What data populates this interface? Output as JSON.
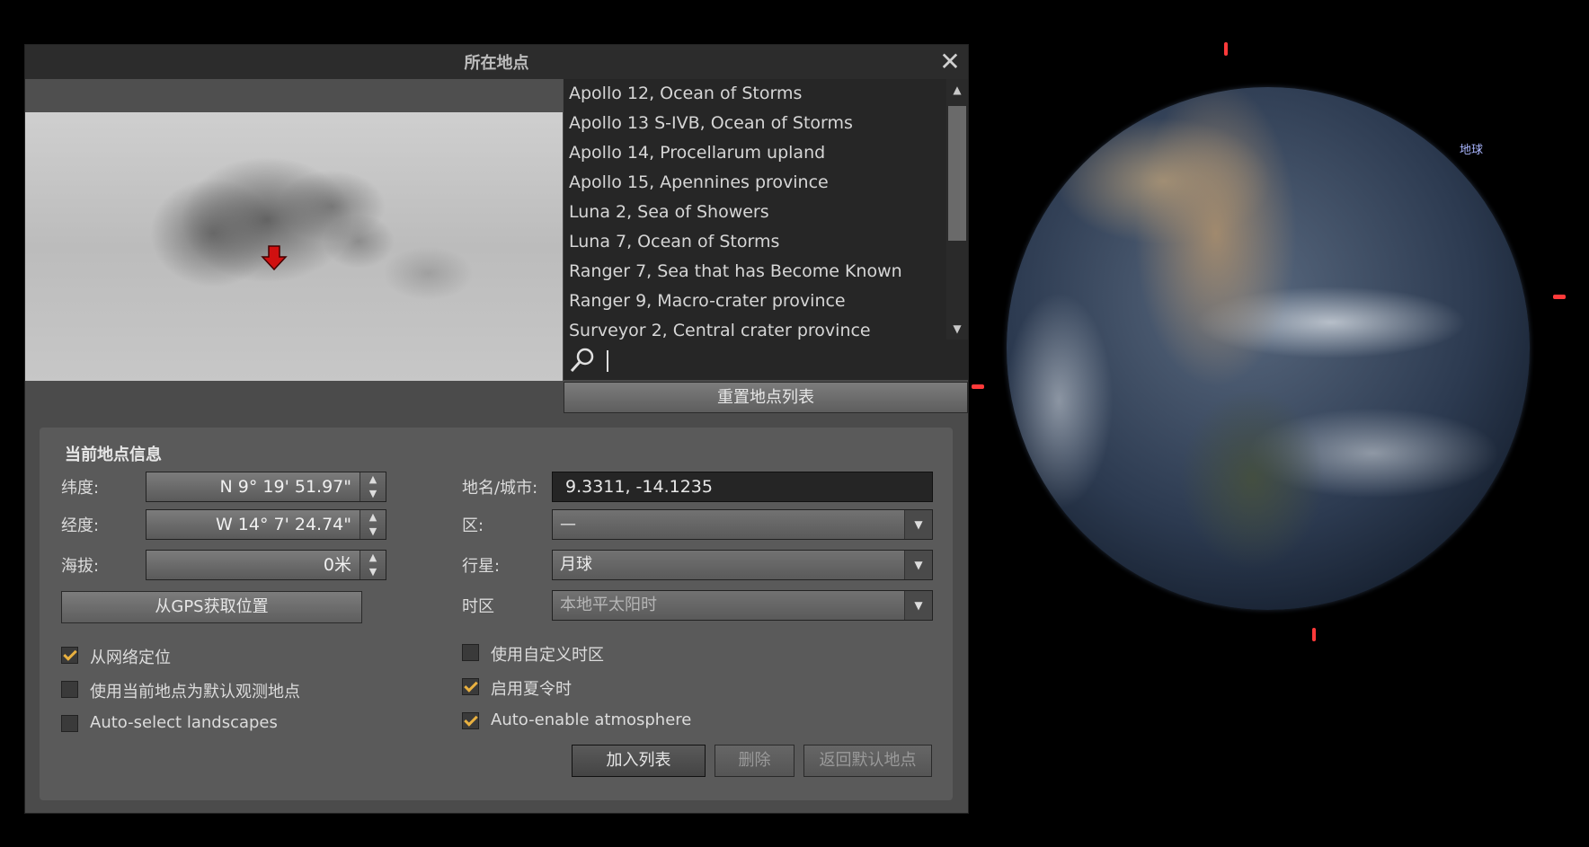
{
  "window": {
    "title": "所在地点"
  },
  "space": {
    "planet_label": "地球"
  },
  "locations": [
    "Apollo 12, Ocean of Storms",
    "Apollo 13 S-IVB, Ocean of Storms",
    "Apollo 14, Procellarum upland",
    "Apollo 15, Apennines province",
    "Luna 2, Sea of Showers",
    "Luna 7, Ocean of Storms",
    "Ranger 7, Sea that has Become Known",
    "Ranger 9, Macro-crater province",
    "Surveyor 2, Central crater province"
  ],
  "search": {
    "value": ""
  },
  "reset_list_label": "重置地点列表",
  "info": {
    "title": "当前地点信息",
    "latitude_label": "纬度:",
    "latitude_value": "N 9° 19' 51.97\"",
    "longitude_label": "经度:",
    "longitude_value": "W 14° 7' 24.74\"",
    "altitude_label": "海拔:",
    "altitude_value": "0米",
    "gps_button": "从GPS获取位置",
    "network_locate": {
      "label": "从网络定位",
      "checked": true
    },
    "use_default": {
      "label": "使用当前地点为默认观测地点",
      "checked": false
    },
    "auto_landscapes": {
      "label": "Auto-select landscapes",
      "checked": false
    },
    "name_label": "地名/城市:",
    "name_value": "9.3311, -14.1235",
    "region_label": "区:",
    "region_value": "—",
    "planet_label": "行星:",
    "planet_value": "月球",
    "timezone_label": "时区",
    "timezone_value": "本地平太阳时",
    "custom_tz": {
      "label": "使用自定义时区",
      "checked": false
    },
    "dst": {
      "label": "启用夏令时",
      "checked": true
    },
    "atmosphere": {
      "label": "Auto-enable atmosphere",
      "checked": true
    },
    "add_button": "加入列表",
    "delete_button": "删除",
    "return_default_button": "返回默认地点"
  },
  "colors": {
    "checkmark": "#e8b040",
    "marker": "#d01010",
    "tick": "#ff3a3a"
  }
}
